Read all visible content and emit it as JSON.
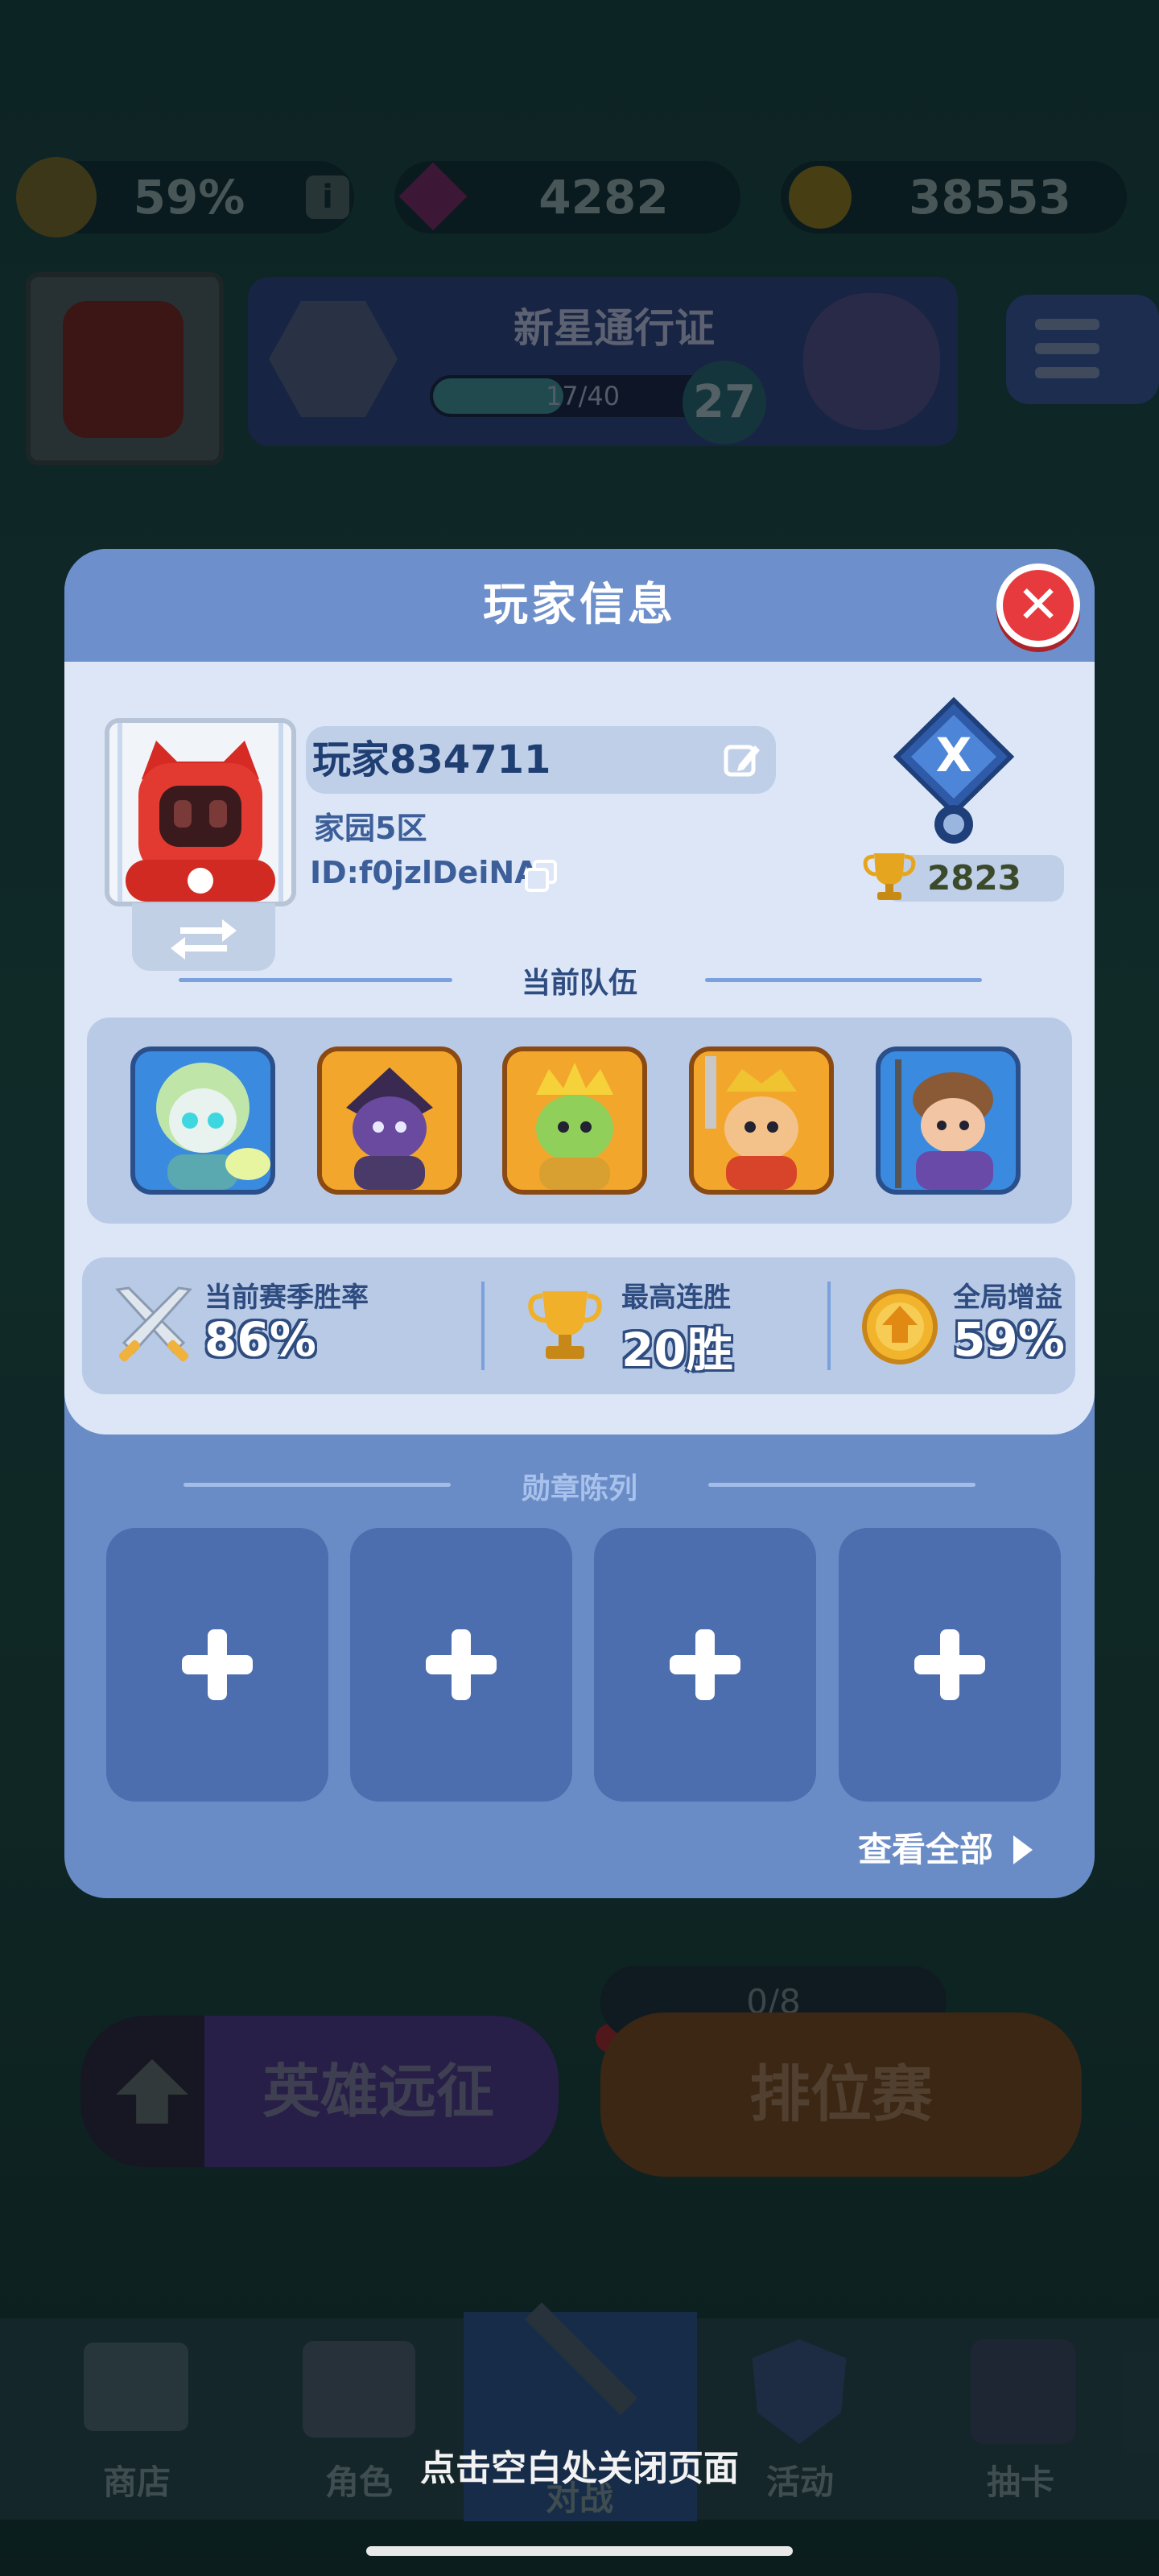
{
  "topbar": {
    "boost": "59%",
    "gems": "4282",
    "coins": "38553"
  },
  "pass": {
    "title": "新星通行证",
    "progress_text": "17/40",
    "progress_fraction": 0.425,
    "level": "27"
  },
  "modal": {
    "title": "玩家信息",
    "player_name": "玩家834711",
    "zone": "家园5区",
    "id": "ID:f0jzlDeiNA",
    "rank_letter": "X",
    "trophies": "2823",
    "team_title": "当前队伍",
    "stats": [
      {
        "label": "当前赛季胜率",
        "value": "86%"
      },
      {
        "label": "最高连胜",
        "value": "20胜"
      },
      {
        "label": "全局增益",
        "value": "59%"
      }
    ],
    "medal_title": "勋章陈列",
    "view_all": "查看全部"
  },
  "bottom": {
    "expedition": "英雄远征",
    "ranked": "排位赛",
    "ranked_counter": "0/8"
  },
  "nav": {
    "items": [
      "商店",
      "角色",
      "对战",
      "活动",
      "抽卡"
    ]
  },
  "close_hint": "点击空白处关闭页面",
  "colors": {
    "modal_blue": "#6a8cc6",
    "panel_light": "#dce6f6",
    "close_red": "#e63a3f",
    "trophy_gold": "#e6a51e"
  }
}
